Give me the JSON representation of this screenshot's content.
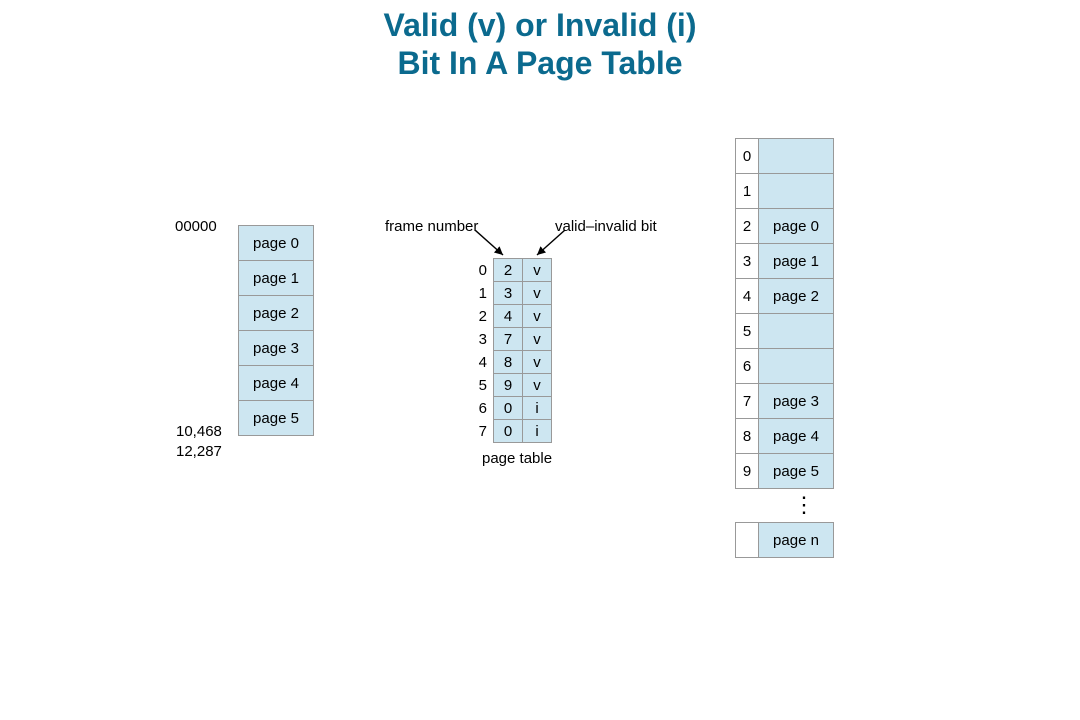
{
  "title_line1": "Valid (v) or Invalid (i)",
  "title_line2": "Bit In A Page Table",
  "labels": {
    "frame_number": "frame number",
    "valid_invalid_bit": "valid–invalid bit",
    "page_table": "page table",
    "addr_low": "00000",
    "addr_mid": "10,468",
    "addr_high": "12,287"
  },
  "logical_pages": [
    {
      "label": "page 0"
    },
    {
      "label": "page 1"
    },
    {
      "label": "page 2"
    },
    {
      "label": "page 3"
    },
    {
      "label": "page 4"
    },
    {
      "label": "page 5"
    }
  ],
  "page_table": [
    {
      "index": "0",
      "frame": "2",
      "bit": "v"
    },
    {
      "index": "1",
      "frame": "3",
      "bit": "v"
    },
    {
      "index": "2",
      "frame": "4",
      "bit": "v"
    },
    {
      "index": "3",
      "frame": "7",
      "bit": "v"
    },
    {
      "index": "4",
      "frame": "8",
      "bit": "v"
    },
    {
      "index": "5",
      "frame": "9",
      "bit": "v"
    },
    {
      "index": "6",
      "frame": "0",
      "bit": "i"
    },
    {
      "index": "7",
      "frame": "0",
      "bit": "i"
    }
  ],
  "memory_frames": [
    {
      "index": "0",
      "label": ""
    },
    {
      "index": "1",
      "label": ""
    },
    {
      "index": "2",
      "label": "page 0"
    },
    {
      "index": "3",
      "label": "page 1"
    },
    {
      "index": "4",
      "label": "page 2"
    },
    {
      "index": "5",
      "label": ""
    },
    {
      "index": "6",
      "label": ""
    },
    {
      "index": "7",
      "label": "page 3"
    },
    {
      "index": "8",
      "label": "page 4"
    },
    {
      "index": "9",
      "label": "page 5"
    }
  ],
  "memory_tail": {
    "label": "page n"
  },
  "ellipsis": "⋮"
}
